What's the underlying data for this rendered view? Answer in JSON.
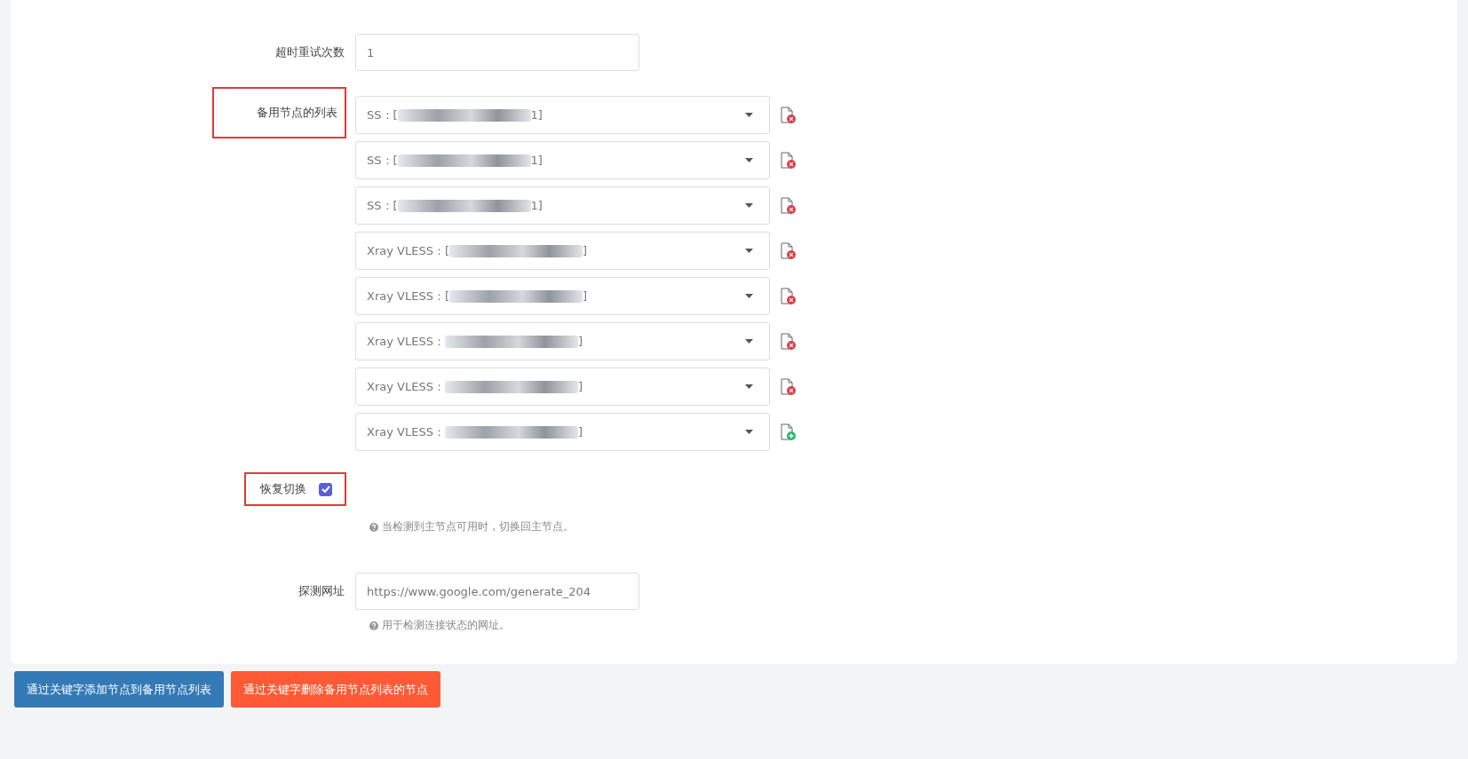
{
  "form": {
    "retry": {
      "label": "超时重试次数",
      "value": "1",
      "highlighted": false
    },
    "backup_nodes": {
      "label": "备用节点的列表",
      "highlighted": true,
      "items": [
        {
          "prefix": "SS：[",
          "suffix": "1]",
          "kind": "remove"
        },
        {
          "prefix": "SS：[",
          "suffix": "1]",
          "kind": "remove"
        },
        {
          "prefix": "SS：[",
          "suffix": "1]",
          "kind": "remove"
        },
        {
          "prefix": "Xray VLESS：[",
          "suffix": "]",
          "kind": "remove"
        },
        {
          "prefix": "Xray VLESS：[",
          "suffix": "]",
          "kind": "remove"
        },
        {
          "prefix": "Xray VLESS：",
          "suffix": "]",
          "kind": "remove"
        },
        {
          "prefix": "Xray VLESS：",
          "suffix": "]",
          "kind": "remove"
        },
        {
          "prefix": "Xray VLESS：",
          "suffix": "]",
          "kind": "add"
        }
      ]
    },
    "restore": {
      "label": "恢复切换",
      "checked": true,
      "highlighted": true,
      "help": "当检测到主节点可用时，切换回主节点。"
    },
    "probe_url": {
      "label": "探测网址",
      "value": "https://www.google.com/generate_204",
      "highlighted": false,
      "help": "用于检测连接状态的网址。"
    }
  },
  "buttons": [
    {
      "label": "通过关键字添加节点到备用节点列表",
      "kind": "primary"
    },
    {
      "label": "通过关键字删除备用节点列表的节点",
      "kind": "danger"
    }
  ]
}
